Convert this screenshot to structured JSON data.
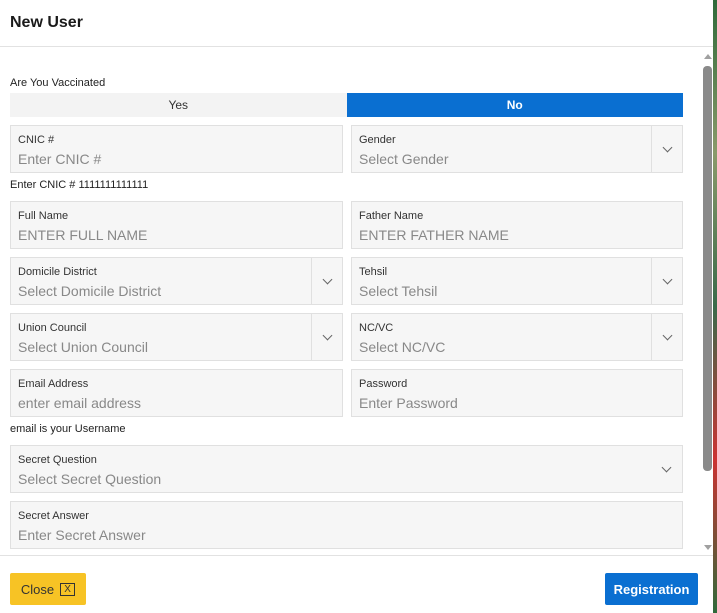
{
  "title": "New User",
  "vaccinated": {
    "label": "Are You Vaccinated",
    "options": [
      "Yes",
      "No"
    ],
    "selected": "No"
  },
  "fields": {
    "cnic": {
      "label": "CNIC #",
      "placeholder": "Enter CNIC #",
      "hint": "Enter CNIC # 1111111111111"
    },
    "gender": {
      "label": "Gender",
      "placeholder": "Select Gender"
    },
    "full_name": {
      "label": "Full Name",
      "placeholder": "ENTER FULL NAME"
    },
    "father_name": {
      "label": "Father Name",
      "placeholder": "ENTER FATHER NAME"
    },
    "district": {
      "label": "Domicile District",
      "placeholder": "Select Domicile District"
    },
    "tehsil": {
      "label": "Tehsil",
      "placeholder": "Select Tehsil"
    },
    "union_council": {
      "label": "Union Council",
      "placeholder": "Select Union Council"
    },
    "ncvc": {
      "label": "NC/VC",
      "placeholder": "Select NC/VC"
    },
    "email": {
      "label": "Email Address",
      "placeholder": "enter email address",
      "hint": "email is your Username"
    },
    "password": {
      "label": "Password",
      "placeholder": "Enter Password"
    },
    "secret_question": {
      "label": "Secret Question",
      "placeholder": "Select Secret Question"
    },
    "secret_answer": {
      "label": "Secret Answer",
      "placeholder": "Enter Secret Answer"
    }
  },
  "footer": {
    "close": "Close",
    "close_icon": "X",
    "register": "Registration"
  },
  "colors": {
    "primary": "#0a6fd1",
    "warning": "#f7c325"
  }
}
